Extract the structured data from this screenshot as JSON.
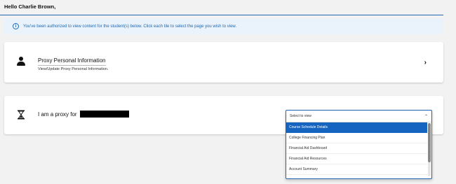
{
  "greeting": "Hello Charlie Brown,",
  "info_banner": {
    "icon": "info-icon",
    "text": "You've been authorized to view content for the student(s) below. Click each tile to select the page you wish to view."
  },
  "proxy_info_card": {
    "icon": "person-icon",
    "title": "Proxy Personal Information",
    "subtitle": "View/Update Proxy Personal Information.",
    "chevron": "chevron-right-icon"
  },
  "proxy_for_card": {
    "icon": "hourglass-icon",
    "label": "I am a proxy for"
  },
  "dropdown": {
    "selected": "Select to view",
    "options": [
      "Course Schedule Details",
      "College Financing Plan",
      "Financial Aid Dashboard",
      "Financial Aid Resources",
      "Account Summary"
    ],
    "highlighted_index": 0
  },
  "colors": {
    "accent": "#1f67b1",
    "banner_bg": "#eaf3fb",
    "highlight": "#1565c0"
  }
}
